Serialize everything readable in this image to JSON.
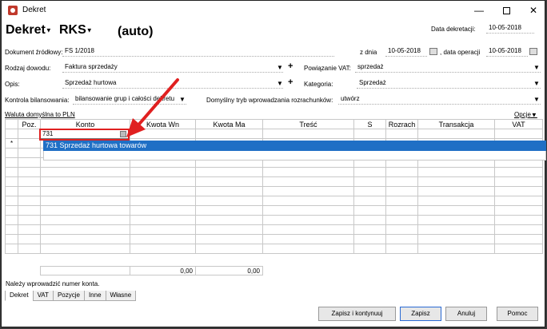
{
  "window": {
    "title": "Dekret"
  },
  "header": {
    "doc_type": "Dekret",
    "doc_kind": "RKS",
    "auto_label": "(auto)",
    "date_label": "Data dekretacji:",
    "date_value": "10-05-2018"
  },
  "form": {
    "source_doc_label": "Dokument źródłowy:",
    "source_doc_value": "FS 1/2018",
    "from_day_label": "z dnia",
    "from_day_value": "10-05-2018",
    "op_date_label": ", data operacji",
    "op_date_value": "10-05-2018",
    "proof_type_label": "Rodzaj dowodu:",
    "proof_type_value": "Faktura sprzedaży",
    "vat_link_label": "Powiązanie VAT:",
    "vat_link_value": "sprzedaż",
    "desc_label": "Opis:",
    "desc_value": "Sprzedaż hurtowa",
    "category_label": "Kategoria:",
    "category_value": "Sprzedaż",
    "balance_label": "Kontrola bilansowania:",
    "balance_value": "bilansowanie grup i całości dekretu",
    "entry_mode_label": "Domyślny tryb wprowadzania rozrachunków:",
    "entry_mode_value": "utwórz",
    "currency_link": "Waluta domyślna to PLN",
    "options_link": "Opcje"
  },
  "grid": {
    "columns": [
      "Poz.",
      "Konto",
      "Kwota Wn",
      "Kwota Ma",
      "Treść",
      "S",
      "Rozrach",
      "Transakcja",
      "VAT"
    ],
    "new_row_marker": "*",
    "edit_value": "731",
    "dropdown_item": "731 Sprzedaż hurtowa towarów",
    "sum_wn": "0,00",
    "sum_ma": "0,00"
  },
  "status": {
    "message": "Należy wprowadzić numer konta."
  },
  "tabs": [
    "Dekret",
    "VAT",
    "Pozycje",
    "Inne",
    "Własne"
  ],
  "buttons": {
    "save_continue": "Zapisz i kontynuuj",
    "save": "Zapisz",
    "cancel": "Anuluj",
    "help": "Pomoc"
  },
  "colors": {
    "accent": "#1f6fc5",
    "highlight": "#e02020"
  }
}
